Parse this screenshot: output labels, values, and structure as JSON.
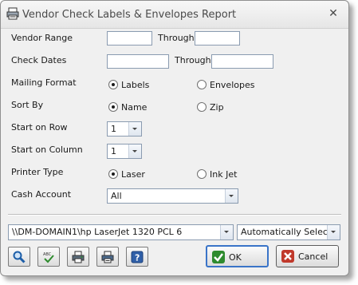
{
  "window": {
    "title": "Vendor Check Labels & Envelopes Report",
    "close_glyph": "✕"
  },
  "form": {
    "vendor_range": {
      "label": "Vendor Range",
      "through": "Through",
      "from_value": "",
      "to_value": ""
    },
    "check_dates": {
      "label": "Check Dates",
      "through": "Through",
      "from_value": "",
      "to_value": ""
    },
    "mailing_format": {
      "label": "Mailing Format",
      "options": [
        "Labels",
        "Envelopes"
      ],
      "selected": "Labels"
    },
    "sort_by": {
      "label": "Sort By",
      "options": [
        "Name",
        "Zip"
      ],
      "selected": "Name"
    },
    "start_row": {
      "label": "Start on Row",
      "value": "1"
    },
    "start_column": {
      "label": "Start on Column",
      "value": "1"
    },
    "printer_type": {
      "label": "Printer Type",
      "options": [
        "Laser",
        "Ink Jet"
      ],
      "selected": "Laser"
    },
    "cash_account": {
      "label": "Cash Account",
      "value": "All"
    }
  },
  "printer": {
    "name": "\\\\DM-DOMAIN1\\hp LaserJet 1320 PCL 6",
    "tray": "Automatically Select"
  },
  "toolbar": {
    "icons": [
      "preview-icon",
      "spell-check-icon",
      "print-setup-icon",
      "print-icon",
      "help-icon"
    ]
  },
  "buttons": {
    "ok": "OK",
    "cancel": "Cancel"
  },
  "colors": {
    "ok_green": "#2e8b2e",
    "cancel_red": "#c0392b",
    "focus_blue": "#3a74c8"
  }
}
